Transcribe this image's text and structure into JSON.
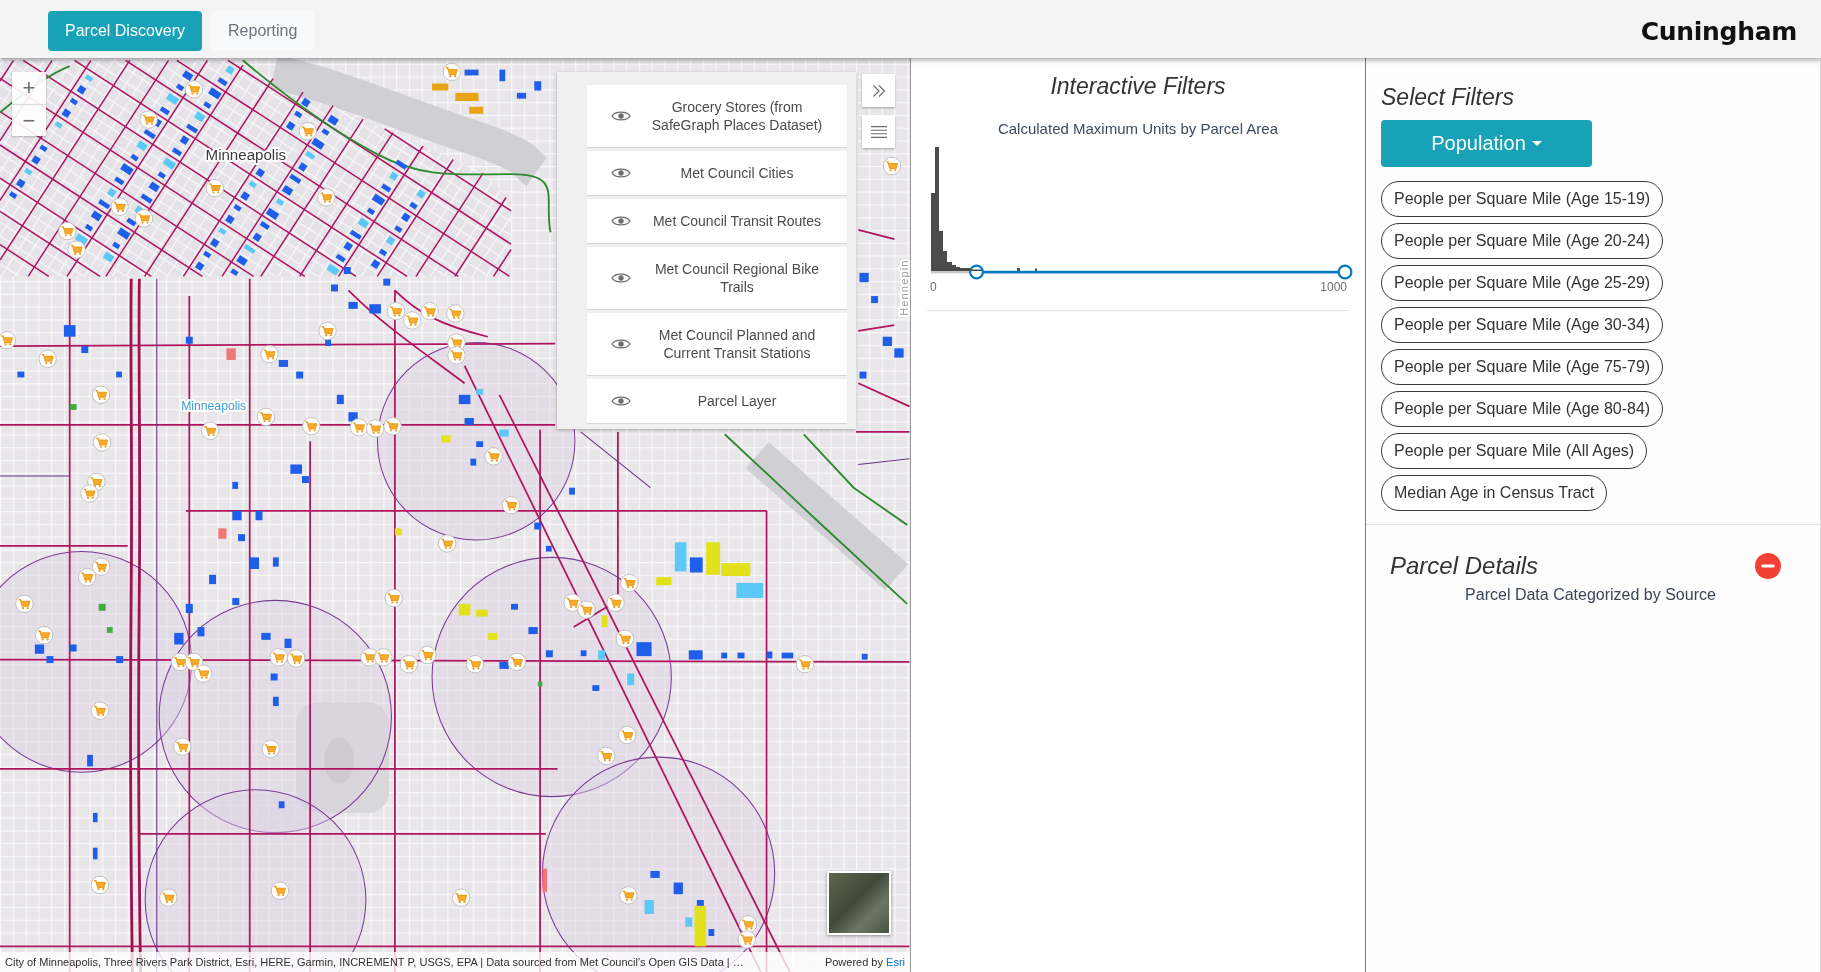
{
  "nav": {
    "tabs": [
      {
        "label": "Parcel Discovery",
        "selected": true
      },
      {
        "label": "Reporting",
        "selected": false
      }
    ],
    "logo": "Cuningham"
  },
  "map": {
    "zoom_controls": [
      "+",
      "−"
    ],
    "labels": [
      {
        "text": "Minneapolis",
        "kind": "city"
      },
      {
        "text": "Minneapolis",
        "kind": "area"
      },
      {
        "text": "Hennepin",
        "kind": "street"
      }
    ],
    "layers": [
      {
        "label": "Grocery Stores (from SafeGraph Places Dataset)",
        "visible": true
      },
      {
        "label": "Met Council Cities",
        "visible": true
      },
      {
        "label": "Met Council Transit Routes",
        "visible": true
      },
      {
        "label": "Met Council Regional Bike Trails",
        "visible": true
      },
      {
        "label": "Met Council Planned and Current Transit Stations",
        "visible": true
      },
      {
        "label": "Parcel Layer",
        "visible": true
      }
    ],
    "attribution": {
      "sources": "City of Minneapolis, Three Rivers Park District, Esri, HERE, Garmin, INCREMENT P, USGS, EPA | Data sourced from Met Council's Open GIS Data | …",
      "powered_by": "Powered by",
      "link": "Esri"
    }
  },
  "interactive_filters": {
    "title": "Interactive Filters",
    "subtitle": "Calculated Maximum Units by Parcel Area",
    "slider": {
      "min_label": "0",
      "max_label": "1000",
      "thumbs": [
        {
          "level": 0.11
        },
        {
          "level": 1
        }
      ]
    }
  },
  "select_filters": {
    "title": "Select Filters",
    "dropdown": "Population",
    "options": [
      "People per Square Mile (Age 15-19)",
      "People per Square Mile (Age 20-24)",
      "People per Square Mile (Age 25-29)",
      "People per Square Mile (Age 30-34)",
      "People per Square Mile (Age 75-79)",
      "People per Square Mile (Age 80-84)",
      "People per Square Mile (All Ages)",
      "Median Age in Census Tract"
    ]
  },
  "parcel_details": {
    "title": "Parcel Details",
    "subtitle": "Parcel Data Categorized by Source",
    "expanded": true
  }
}
